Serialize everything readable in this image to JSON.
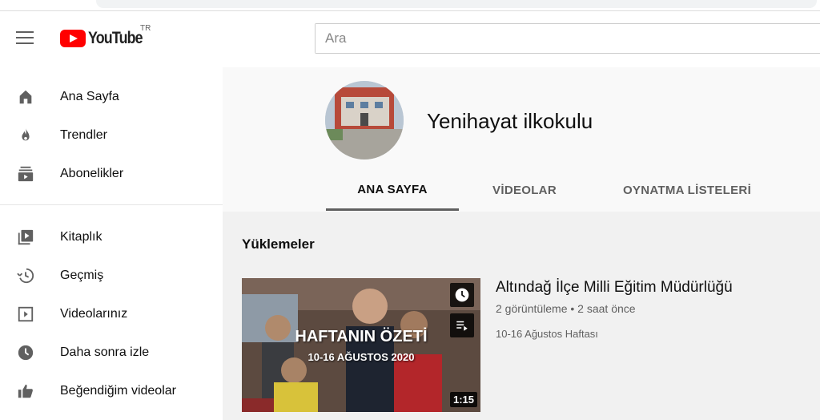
{
  "masthead": {
    "logo_text": "YouTube",
    "region": "TR",
    "search_placeholder": "Ara"
  },
  "sidebar": {
    "items": [
      {
        "label": "Ana Sayfa",
        "icon": "home-icon"
      },
      {
        "label": "Trendler",
        "icon": "fire-icon"
      },
      {
        "label": "Abonelikler",
        "icon": "subscriptions-icon"
      },
      {
        "label": "Kitaplık",
        "icon": "library-icon"
      },
      {
        "label": "Geçmiş",
        "icon": "history-icon"
      },
      {
        "label": "Videolarınız",
        "icon": "your-videos-icon"
      },
      {
        "label": "Daha sonra izle",
        "icon": "clock-icon"
      },
      {
        "label": "Beğendiğim videolar",
        "icon": "thumbs-up-icon"
      }
    ]
  },
  "channel": {
    "name": "Yenihayat ilkokulu",
    "tabs": [
      "ANA SAYFA",
      "VİDEOLAR",
      "OYNATMA LİSTELERİ"
    ],
    "active_tab": "ANA SAYFA"
  },
  "content": {
    "section_title": "Yüklemeler",
    "video": {
      "title": "Altındağ İlçe Milli Eğitim Müdürlüğü",
      "meta": "2 görüntüleme • 2 saat önce",
      "description": "10-16 Ağustos Haftası",
      "duration": "1:15",
      "thumb_title": "HAFTANIN ÖZETİ",
      "thumb_subtitle": "10-16 AĞUSTOS 2020"
    }
  },
  "colors": {
    "brand_red": "#ff0000",
    "text_primary": "#0f0f0f",
    "text_secondary": "#606060",
    "background": "#f1f1f1"
  }
}
